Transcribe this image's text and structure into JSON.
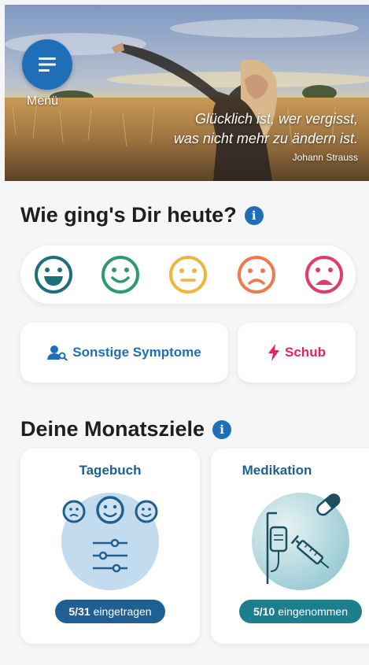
{
  "hero": {
    "menu_label": "Menü",
    "quote_line1": "Glücklich ist, wer vergisst,",
    "quote_line2": "was nicht mehr zu ändern ist.",
    "quote_author": "Johann Strauss"
  },
  "mood_section": {
    "title": "Wie ging's Dir heute?",
    "info_glyph": "i",
    "moods": [
      {
        "icon": "very-happy-icon",
        "color": "#1f6f7a"
      },
      {
        "icon": "happy-icon",
        "color": "#2e9a6e"
      },
      {
        "icon": "neutral-icon",
        "color": "#f0b63c"
      },
      {
        "icon": "sad-icon",
        "color": "#ee7a4e"
      },
      {
        "icon": "very-sad-icon",
        "color": "#e23a6c"
      }
    ]
  },
  "actions": {
    "symptoms_label": "Sonstige Symptome",
    "symptoms_color": "#1f6fb8",
    "flare_label": "Schub",
    "flare_color": "#e2245f"
  },
  "goals_section": {
    "title": "Deine Monatsziele",
    "info_glyph": "i",
    "cards": [
      {
        "title": "Tagebuch",
        "count": "5/31",
        "status": "eingetragen",
        "pill_color": "#1f5f92"
      },
      {
        "title": "Medikation",
        "count": "5/10",
        "status": "eingenommen",
        "pill_color": "#1d7e8e"
      }
    ]
  }
}
